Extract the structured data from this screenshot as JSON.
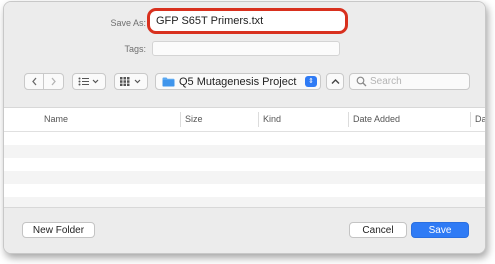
{
  "save_as": {
    "label": "Save As:",
    "value": "GFP S65T Primers.txt"
  },
  "tags": {
    "label": "Tags:",
    "value": ""
  },
  "toolbar": {
    "back_icon": "chevron-left-icon",
    "forward_icon": "chevron-right-icon",
    "list_view_icon": "list-icon",
    "grid_view_icon": "grid-icon",
    "location": "Q5 Mutagenesis Project",
    "search_placeholder": "Search"
  },
  "columns": [
    "Name",
    "Size",
    "Kind",
    "Date Added",
    "Da"
  ],
  "buttons": {
    "new_folder": "New Folder",
    "cancel": "Cancel",
    "save": "Save"
  },
  "colors": {
    "accent": "#2f7bf5",
    "highlight": "#d8301e"
  }
}
